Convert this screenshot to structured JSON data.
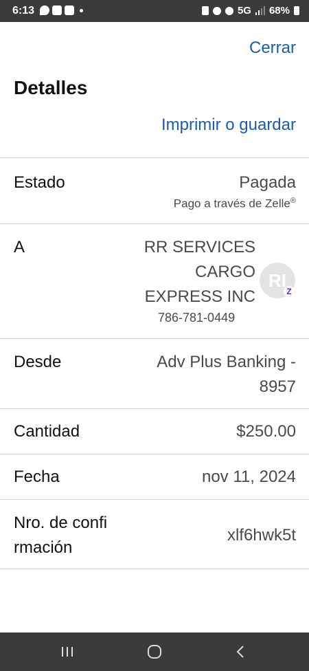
{
  "status_bar": {
    "time": "6:13",
    "network": "5G",
    "battery": "68%"
  },
  "header": {
    "close_label": "Cerrar",
    "title": "Detalles",
    "print_label": "Imprimir o guardar"
  },
  "details": {
    "status": {
      "label": "Estado",
      "value": "Pagada",
      "method": "Pago a través de Zelle",
      "method_mark": "®"
    },
    "recipient": {
      "label": "A",
      "name_line1": "RR SERVICES",
      "name_line2": "CARGO",
      "name_line3": "EXPRESS INC",
      "phone": "786-781-0449",
      "avatar_initials": "RI",
      "badge": "Z"
    },
    "source": {
      "label": "Desde",
      "value_line1": "Adv Plus Banking -",
      "value_line2": "8957"
    },
    "amount": {
      "label": "Cantidad",
      "value": "$250.00"
    },
    "date": {
      "label": "Fecha",
      "value": "nov 11, 2024"
    },
    "confirmation": {
      "label_line1": "Nro. de confi",
      "label_line2": "rmación",
      "value": "xlf6hwk5t"
    }
  },
  "colors": {
    "link": "#1a5cad",
    "zelle": "#6d1ed4",
    "system_bars": "#3b3b3b"
  }
}
